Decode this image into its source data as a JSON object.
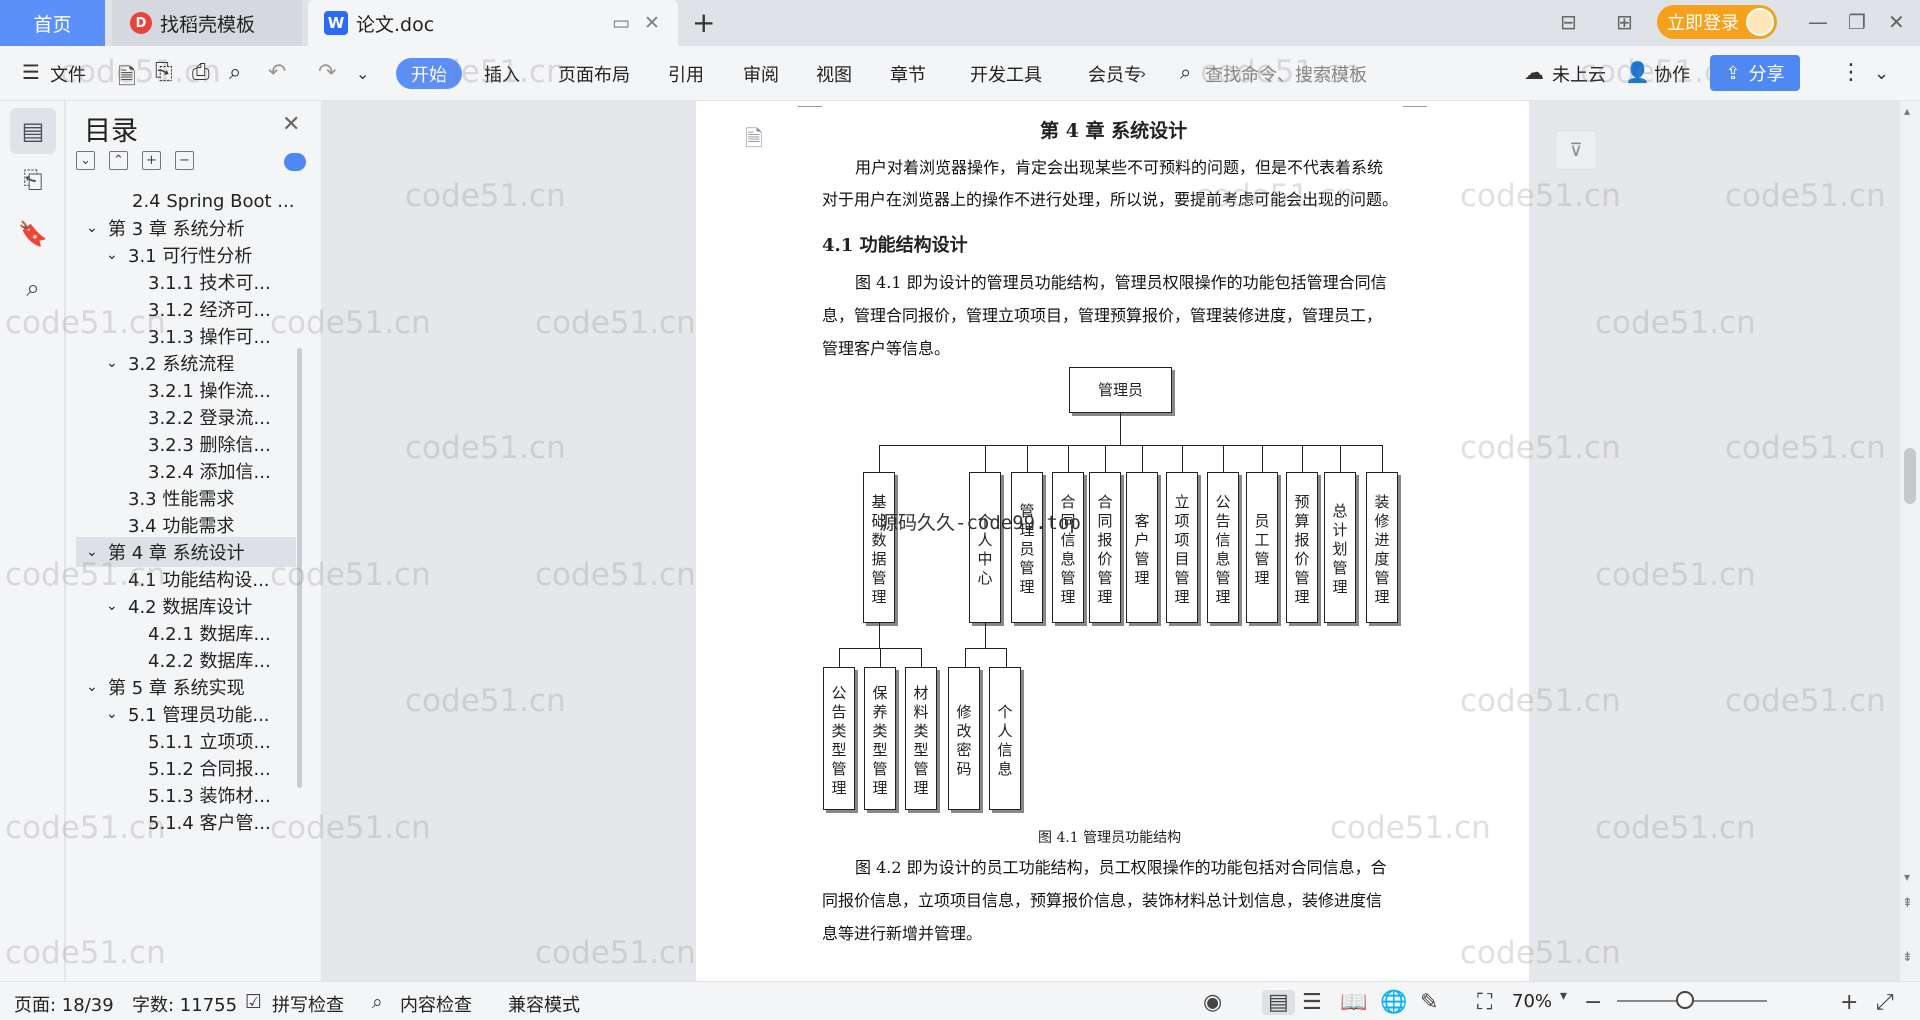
{
  "tabs": {
    "home": "首页",
    "template": "找稻壳模板",
    "document": "论文.doc",
    "login": "立即登录"
  },
  "ribbon": {
    "file": "文件",
    "start": "开始",
    "insert": "插入",
    "layout": "页面布局",
    "reference": "引用",
    "review": "审阅",
    "view": "视图",
    "chapter": "章节",
    "devtools": "开发工具",
    "member": "会员专",
    "search_placeholder": "查找命令、搜索模板",
    "cloud": "未上云",
    "collab": "协作",
    "share": "分享"
  },
  "outline": {
    "title": "目录",
    "items": [
      {
        "label": "2.4 Spring Boot ..."
      },
      {
        "label": "第 3 章  系统分析"
      },
      {
        "label": "3.1  可行性分析"
      },
      {
        "label": "3.1.1  技术可..."
      },
      {
        "label": "3.1.2  经济可..."
      },
      {
        "label": "3.1.3  操作可..."
      },
      {
        "label": "3.2  系统流程"
      },
      {
        "label": "3.2.1  操作流..."
      },
      {
        "label": "3.2.2  登录流..."
      },
      {
        "label": "3.2.3  删除信..."
      },
      {
        "label": "3.2.4  添加信..."
      },
      {
        "label": "3.3  性能需求"
      },
      {
        "label": "3.4  功能需求"
      },
      {
        "label": "第 4 章  系统设计"
      },
      {
        "label": "4.1  功能结构设..."
      },
      {
        "label": "4.2  数据库设计"
      },
      {
        "label": "4.2.1  数据库..."
      },
      {
        "label": "4.2.2  数据库..."
      },
      {
        "label": "第 5 章  系统实现"
      },
      {
        "label": "5.1  管理员功能..."
      },
      {
        "label": "5.1.1  立项项..."
      },
      {
        "label": "5.1.2  合同报..."
      },
      {
        "label": "5.1.3  装饰材..."
      },
      {
        "label": "5.1.4  客户管..."
      }
    ]
  },
  "document": {
    "chapter_title": "第 4 章  系统设计",
    "para1_line1": "用户对着浏览器操作，肯定会出现某些不可预料的问题，但是不代表着系统",
    "para1_line2": "对于用户在浏览器上的操作不进行处理，所以说，要提前考虑可能会出现的问题。",
    "section_title": "4.1  功能结构设计",
    "para2_line1": "图 4.1 即为设计的管理员功能结构，管理员权限操作的功能包括管理合同信",
    "para2_line2": "息，管理合同报价，管理立项项目，管理预算报价，管理装修进度，管理员工，",
    "para2_line3": "管理客户等信息。",
    "diagram": {
      "root": "管理员",
      "level1": [
        "基础数据管理",
        "个人中心",
        "管理员管理",
        "合同信息管理",
        "合同报价管理",
        "客户管理",
        "立项项目管理",
        "公告信息管理",
        "员工管理",
        "预算报价管理",
        "总计划管理",
        "装修进度管理"
      ],
      "level2": [
        "公告类型管理",
        "保养类型管理",
        "材料类型管理",
        "修改密码",
        "个人信息"
      ]
    },
    "figure_caption": "图 4.1  管理员功能结构",
    "para3_line1": "图 4.2 即为设计的员工功能结构，员工权限操作的功能包括对合同信息，合",
    "para3_line2": "同报价信息，立项项目信息，预算报价信息，装饰材料总计划信息，装修进度信",
    "para3_line3": "息等进行新增并管理。"
  },
  "watermark": {
    "text": "code51.cn",
    "overlay": "源码久久-code99.top"
  },
  "statusbar": {
    "page": "页面: 18/39",
    "words": "字数: 11755",
    "spellcheck": "拼写检查",
    "contentcheck": "内容检查",
    "compat": "兼容模式",
    "zoom": "70%"
  }
}
